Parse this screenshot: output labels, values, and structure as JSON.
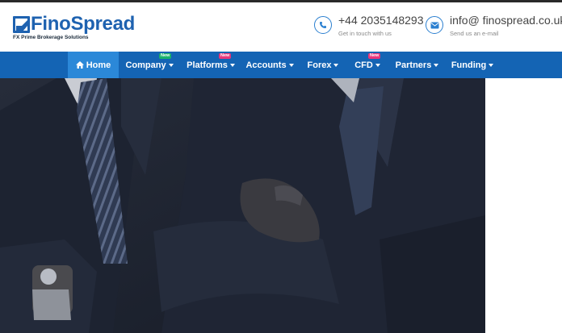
{
  "brand": {
    "name": "FinoSpread",
    "tagline": "FX Prime Brokerage Solutions",
    "color": "#1e62b0"
  },
  "contacts": {
    "phone": {
      "value": "+44 2035148293",
      "caption": "Get in touch with us",
      "icon": "phone-icon"
    },
    "email": {
      "value": "info@ finospread.co.uk",
      "caption": "Send us an e-mail",
      "icon": "envelope-icon"
    }
  },
  "nav": {
    "background": "#1464b4",
    "active_background": "#2b88d8",
    "items": [
      {
        "label": "Home",
        "icon": "home-icon",
        "active": true
      },
      {
        "label": "Company",
        "badge": "New",
        "badge_color": "#19b26b",
        "dropdown": true
      },
      {
        "label": "Platforms",
        "badge": "New",
        "badge_color": "#e8357a",
        "dropdown": true
      },
      {
        "label": "Accounts",
        "dropdown": true
      },
      {
        "label": "Forex",
        "dropdown": true
      },
      {
        "label": "CFD",
        "badge": "New",
        "badge_color": "#e8357a",
        "dropdown": true
      },
      {
        "label": "Partners",
        "dropdown": true
      },
      {
        "label": "Funding",
        "dropdown": true
      }
    ]
  },
  "hero": {
    "image": "business-people-in-suits-photo"
  }
}
